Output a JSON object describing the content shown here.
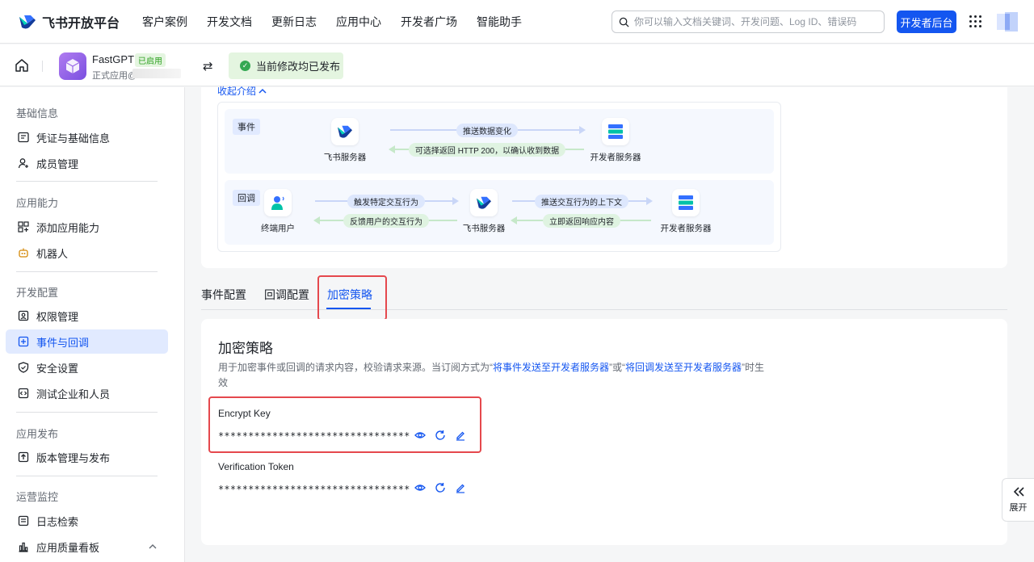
{
  "brand": {
    "name": "飞书开放平台"
  },
  "nav": [
    "客户案例",
    "开发文档",
    "更新日志",
    "应用中心",
    "开发者广场",
    "智能助手"
  ],
  "search": {
    "placeholder": "你可以输入文档关键词、开发问题、Log ID、错误码"
  },
  "dev_console": "开发者后台",
  "app": {
    "name": "FastGPT",
    "badge": "已启用",
    "sub": "正式应用@"
  },
  "publish_status": "当前修改均已发布",
  "sidebar": {
    "groups": [
      {
        "title": "基础信息",
        "items": [
          {
            "label": "凭证与基础信息",
            "icon": "credential-icon"
          },
          {
            "label": "成员管理",
            "icon": "member-icon"
          }
        ]
      },
      {
        "title": "应用能力",
        "items": [
          {
            "label": "添加应用能力",
            "icon": "add-capability-icon"
          },
          {
            "label": "机器人",
            "icon": "robot-icon"
          }
        ]
      },
      {
        "title": "开发配置",
        "items": [
          {
            "label": "权限管理",
            "icon": "permission-icon"
          },
          {
            "label": "事件与回调",
            "icon": "event-callback-icon",
            "active": true
          },
          {
            "label": "安全设置",
            "icon": "shield-icon"
          },
          {
            "label": "测试企业和人员",
            "icon": "test-icon"
          }
        ]
      },
      {
        "title": "应用发布",
        "items": [
          {
            "label": "版本管理与发布",
            "icon": "version-icon"
          }
        ]
      },
      {
        "title": "运营监控",
        "items": [
          {
            "label": "日志检索",
            "icon": "log-icon"
          },
          {
            "label": "应用质量看板",
            "icon": "chart-icon"
          }
        ]
      }
    ]
  },
  "intro": {
    "collapse": "收起介绍",
    "event": {
      "tag": "事件",
      "left_label": "飞书服务器",
      "right_label": "开发者服务器",
      "forward": "推送数据变化",
      "back": "可选择返回 HTTP 200，以确认收到数据"
    },
    "callback": {
      "tag": "回调",
      "user_label": "终端用户",
      "mid_label": "飞书服务器",
      "right_label": "开发者服务器",
      "forward1": "触发特定交互行为",
      "back1": "反馈用户的交互行为",
      "forward2": "推送交互行为的上下文",
      "back2": "立即返回响应内容"
    }
  },
  "tabs": [
    "事件配置",
    "回调配置",
    "加密策略"
  ],
  "active_tab": "加密策略",
  "encrypt": {
    "title": "加密策略",
    "desc_1": "用于加密事件或回调的请求内容，校验请求来源。当订阅方式为“",
    "desc_link1": "将事件发送至开发者服务器",
    "desc_2": "”或“",
    "desc_link2": "将回调发送至开发者服务器",
    "desc_3": "”时生效",
    "encrypt_key_label": "Encrypt Key",
    "encrypt_key_value": "********************************",
    "token_label": "Verification Token",
    "token_value": "********************************"
  },
  "expand": "展开",
  "colors": {
    "primary": "#1456f0",
    "highlight_red": "#e5484d",
    "success": "#34a853"
  }
}
